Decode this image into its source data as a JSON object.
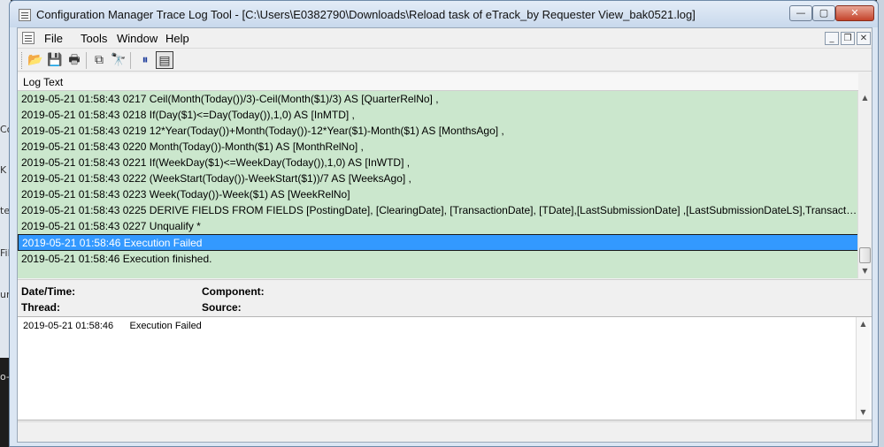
{
  "window": {
    "title": "Configuration Manager Trace Log Tool - [C:\\Users\\E0382790\\Downloads\\Reload task of eTrack_by Requester View_bak0521.log]",
    "minimize_glyph": "—",
    "maximize_glyph": "▢",
    "close_glyph": "✕"
  },
  "menu": {
    "items": [
      "File",
      "Tools",
      "Window",
      "Help"
    ],
    "mdi_minimize": "_",
    "mdi_restore": "❐",
    "mdi_close": "✕"
  },
  "toolbar": {
    "open_glyph": "📂",
    "save_glyph": "💾",
    "print_glyph": "🖶",
    "copy_glyph": "⧉",
    "find_glyph": "🔭",
    "pause_glyph": "⏸",
    "filter_glyph": "▤"
  },
  "log": {
    "column_header": "Log Text",
    "rows": [
      "2019-05-21 01:58:43 0217   Ceil(Month(Today())/3)-Ceil(Month($1)/3) AS [QuarterRelNo] ,",
      "2019-05-21 01:58:43 0218   If(Day($1)<=Day(Today()),1,0) AS [InMTD] ,",
      "2019-05-21 01:58:43 0219   12*Year(Today())+Month(Today())-12*Year($1)-Month($1) AS [MonthsAgo] ,",
      "2019-05-21 01:58:43 0220   Month(Today())-Month($1) AS [MonthRelNo] ,",
      "2019-05-21 01:58:43 0221   If(WeekDay($1)<=WeekDay(Today()),1,0) AS [InWTD] ,",
      "2019-05-21 01:58:43 0222   (WeekStart(Today())-WeekStart($1))/7 AS [WeeksAgo] ,",
      "2019-05-21 01:58:43 0223   Week(Today())-Week($1) AS [WeekRelNo]",
      "2019-05-21 01:58:43 0225 DERIVE FIELDS FROM FIELDS [PostingDate], [ClearingDate], [TransactionDate], [TDate],[LastSubmissionDate] ,[LastSubmissionDateLS],TransactionDate_APMeal ...",
      "2019-05-21 01:58:43 0227 Unqualify *",
      "2019-05-21 01:58:46      Execution Failed",
      "2019-05-21 01:58:46      Execution finished."
    ],
    "selected_index": 9
  },
  "details": {
    "datetime_label": "Date/Time:",
    "component_label": "Component:",
    "thread_label": "Thread:",
    "source_label": "Source:"
  },
  "message": {
    "text": "2019-05-21 01:58:46      Execution Failed"
  },
  "scroll": {
    "up_glyph": "▲",
    "down_glyph": "▼"
  },
  "background": {
    "fragments": [
      "Co",
      "K",
      "ter",
      "Fil",
      "urit",
      "o-g"
    ]
  }
}
